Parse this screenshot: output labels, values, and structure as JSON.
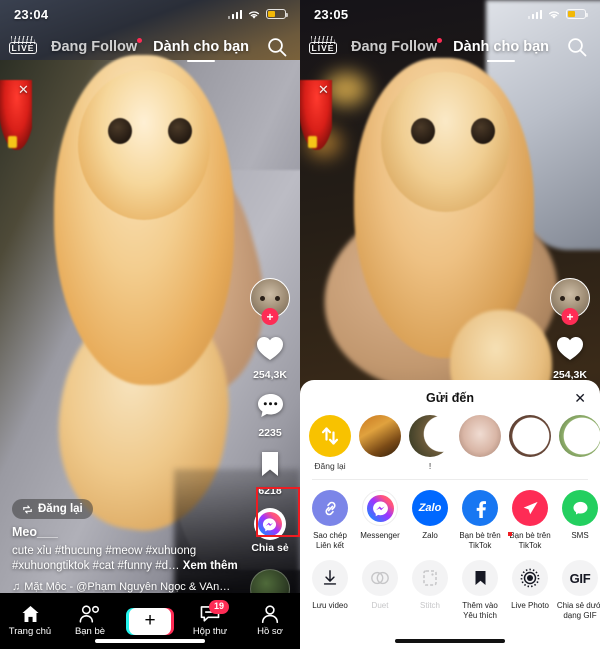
{
  "left": {
    "status": {
      "time": "23:04",
      "battery_pct": 42
    },
    "topbar": {
      "live_label": "LIVE",
      "tab_following": "Đang Follow",
      "tab_foryou": "Dành cho bạn",
      "search_icon": "search-icon",
      "close_icon": "close-x-icon"
    },
    "rail": {
      "follow_plus": "+",
      "like_count": "254,3K",
      "comment_count": "2235",
      "bookmark_count": "6218",
      "share_label": "Chia sẻ"
    },
    "repost_label": "Đăng lại",
    "caption": {
      "username": "Meo___",
      "text": "cute xỉu  #thucung #meow #xuhuong #xuhuongtiktok #cat #funny #d…",
      "more": "Xem thêm",
      "music": "Mặt Mộc - @Phạm Nguyên Ngọc & VAn…"
    },
    "nav": [
      {
        "label": "Trang chủ",
        "icon": "home-icon"
      },
      {
        "label": "Bạn bè",
        "icon": "friends-icon"
      },
      {
        "label": "",
        "icon": "create-plus-icon"
      },
      {
        "label": "Hộp thư",
        "icon": "inbox-icon",
        "badge": "19"
      },
      {
        "label": "Hồ sơ",
        "icon": "profile-icon"
      }
    ]
  },
  "right": {
    "status": {
      "time": "23:05",
      "battery_pct": 42
    },
    "topbar": {
      "live_label": "LIVE",
      "tab_following": "Đang Follow",
      "tab_foryou": "Dành cho bạn",
      "search_icon": "search-icon",
      "close_icon": "close-x-icon"
    },
    "rail": {
      "follow_plus": "+",
      "like_count": "254,3K"
    },
    "sheet": {
      "title": "Gửi đến",
      "close_icon": "close-icon",
      "contacts": [
        {
          "label": "Đăng lại",
          "type": "repost"
        },
        {
          "label": "",
          "type": "avatar"
        },
        {
          "label": "!",
          "type": "avatar"
        },
        {
          "label": "",
          "type": "avatar"
        },
        {
          "label": "",
          "type": "avatar"
        },
        {
          "label": "",
          "type": "avatar"
        }
      ],
      "apps": [
        {
          "label": "Sao chép Liên kết",
          "icon": "link-icon"
        },
        {
          "label": "Messenger",
          "icon": "messenger-icon"
        },
        {
          "label": "Zalo",
          "icon": "zalo-icon"
        },
        {
          "label": "Facebook",
          "icon": "facebook-icon"
        },
        {
          "label": "Bạn bè trên TikTok",
          "icon": "send-icon"
        },
        {
          "label": "SMS",
          "icon": "sms-icon"
        }
      ],
      "actions": [
        {
          "label": "Lưu video",
          "icon": "download-icon",
          "disabled": false
        },
        {
          "label": "Duet",
          "icon": "duet-icon",
          "disabled": true
        },
        {
          "label": "Stitch",
          "icon": "stitch-icon",
          "disabled": true
        },
        {
          "label": "Thêm vào Yêu thích",
          "icon": "bookmark-icon",
          "disabled": false
        },
        {
          "label": "Live Photo",
          "icon": "live-photo-icon",
          "disabled": false
        },
        {
          "label": "Chia sẻ dưới dạng GIF",
          "icon": "gif-icon",
          "disabled": false
        }
      ]
    }
  },
  "highlight_color": "#ee1c22"
}
